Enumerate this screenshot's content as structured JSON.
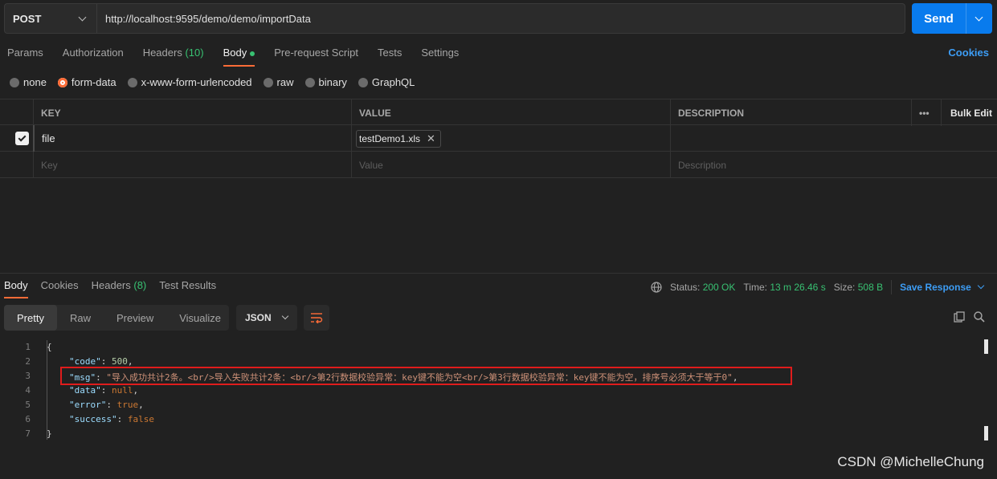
{
  "request": {
    "method": "POST",
    "url": "http://localhost:9595/demo/demo/importData",
    "send_label": "Send"
  },
  "request_tabs": [
    {
      "label": "Params"
    },
    {
      "label": "Authorization"
    },
    {
      "label": "Headers",
      "count": "(10)"
    },
    {
      "label": "Body",
      "active": true
    },
    {
      "label": "Pre-request Script"
    },
    {
      "label": "Tests"
    },
    {
      "label": "Settings"
    }
  ],
  "cookies_label": "Cookies",
  "body_types": [
    "none",
    "form-data",
    "x-www-form-urlencoded",
    "raw",
    "binary",
    "GraphQL"
  ],
  "body_type_selected": "form-data",
  "table": {
    "headers": {
      "key": "KEY",
      "value": "VALUE",
      "description": "DESCRIPTION",
      "more": "•••",
      "bulk_edit": "Bulk Edit"
    },
    "rows": [
      {
        "key": "file",
        "value": "testDemo1.xls",
        "checked": true
      }
    ],
    "placeholders": {
      "key": "Key",
      "value": "Value",
      "description": "Description"
    }
  },
  "response_tabs": [
    {
      "label": "Body",
      "active": true
    },
    {
      "label": "Cookies"
    },
    {
      "label": "Headers",
      "count": "(8)"
    },
    {
      "label": "Test Results"
    }
  ],
  "response_status": {
    "status_label": "Status:",
    "status_value": "200 OK",
    "time_label": "Time:",
    "time_value": "13 m 26.46 s",
    "size_label": "Size:",
    "size_value": "508 B",
    "save_label": "Save Response"
  },
  "view_modes": [
    "Pretty",
    "Raw",
    "Preview",
    "Visualize"
  ],
  "format": "JSON",
  "code_lines": {
    "l1": "{",
    "code_key": "\"code\"",
    "code_val": "500",
    "msg_key": "\"msg\"",
    "msg_val": "\"导入成功共计2条。<br/>导入失败共计2条：<br/>第2行数据校验异常：key键不能为空<br/>第3行数据校验异常：key键不能为空，排序号必须大于等于0\"",
    "data_key": "\"data\"",
    "data_val": "null",
    "error_key": "\"error\"",
    "error_val": "true",
    "success_key": "\"success\"",
    "success_val": "false",
    "l7": "}"
  },
  "watermark": "CSDN @MichelleChung",
  "colors": {
    "accent": "#ff6c37",
    "send": "#097bed",
    "link": "#3d9df5",
    "ok": "#38c172",
    "highlight": "#e01c1c"
  }
}
